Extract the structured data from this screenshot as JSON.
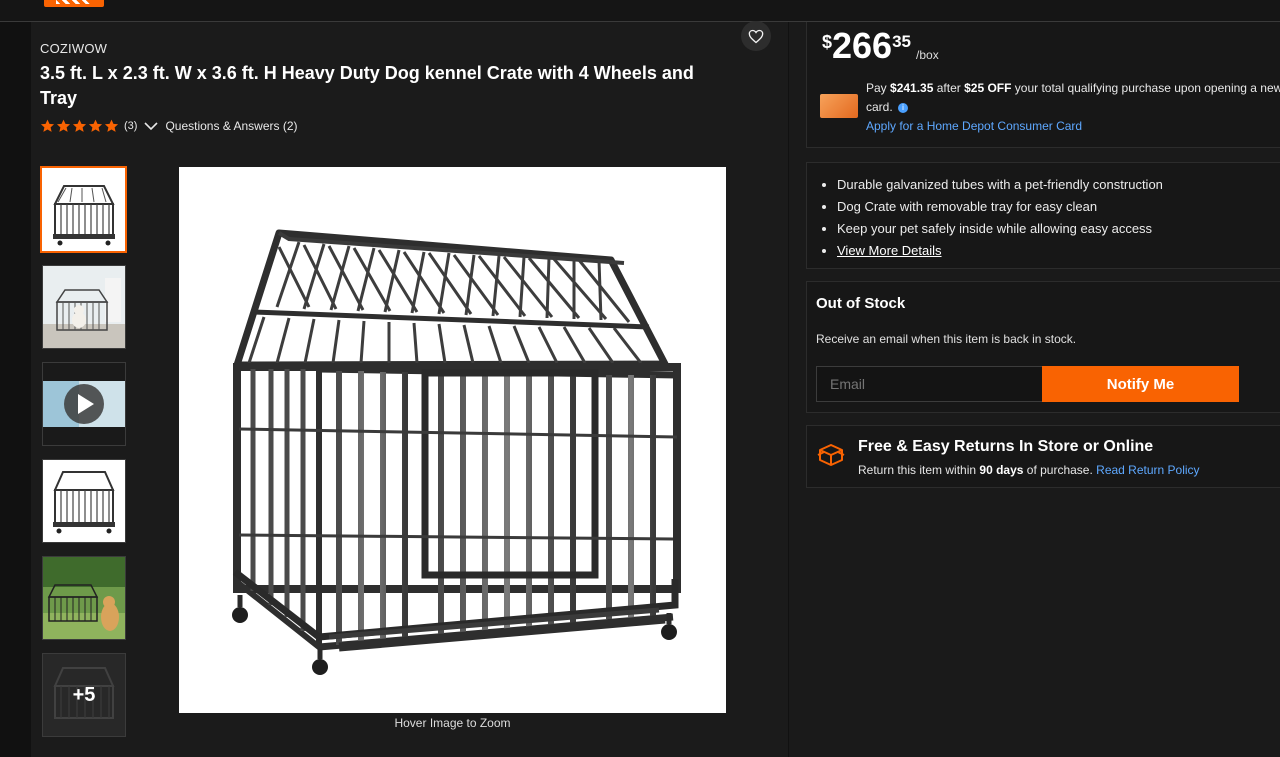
{
  "product": {
    "brand": "COZIWOW",
    "title": "3.5 ft. L x 2.3 ft. W x 3.6 ft. H Heavy Duty Dog kennel Crate with 4 Wheels and Tray",
    "rating": {
      "stars": 5,
      "count": "(3)"
    },
    "qa_label": "Questions & Answers (2)",
    "hover_hint": "Hover Image to Zoom",
    "more_images": "+5"
  },
  "price": {
    "dollar": "$",
    "whole": "266",
    "cents": "35",
    "unit": "/box"
  },
  "credit_offer": {
    "prefix": "Pay ",
    "amount": "$241.35",
    "middle": " after ",
    "discount": "$25 OFF",
    "suffix": " your total qualifying purchase upon opening a new card.",
    "apply_link": "Apply for a Home Depot Consumer Card"
  },
  "features": [
    "Durable galvanized tubes with a pet-friendly construction",
    "Dog Crate with removable tray for easy clean",
    "Keep your pet safely inside while allowing easy access"
  ],
  "view_more": "View More Details",
  "stock": {
    "title": "Out of Stock",
    "message": "Receive an email when this item is back in stock.",
    "email_placeholder": "Email",
    "notify_label": "Notify Me"
  },
  "returns": {
    "title": "Free & Easy Returns In Store or Online",
    "prefix": "Return this item within ",
    "days": "90 days",
    "suffix": " of purchase. ",
    "link": "Read Return Policy"
  },
  "colors": {
    "accent": "#f96302",
    "link": "#5ea8ff",
    "background": "#111111"
  }
}
